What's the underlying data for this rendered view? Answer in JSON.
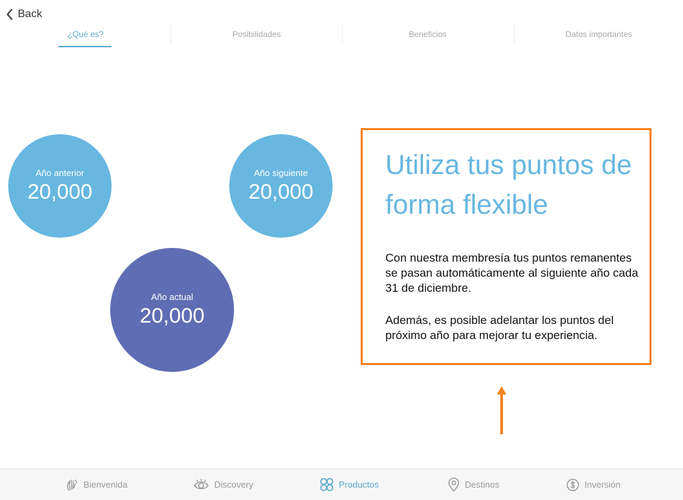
{
  "header": {
    "back_label": "Back"
  },
  "tabs": [
    {
      "label": "¿Qué es?",
      "active": true
    },
    {
      "label": "Posibilidades",
      "active": false
    },
    {
      "label": "Beneficios",
      "active": false
    },
    {
      "label": "Datos importantes",
      "active": false
    }
  ],
  "circles": {
    "previous": {
      "label": "Año anterior",
      "value": "20,000"
    },
    "next": {
      "label": "Año siguiente",
      "value": "20,000"
    },
    "current": {
      "label": "Año actual",
      "value": "20,000"
    }
  },
  "content": {
    "heading": "Utiliza tus puntos de forma flexible",
    "paragraph_1": "Con nuestra membresía tus puntos remanentes se pasan automáticamente al siguiente año cada 31 de diciembre.",
    "paragraph_2": "Además, es posible adelantar los puntos del próximo año para mejorar tu experiencia."
  },
  "bottom_nav": [
    {
      "label": "Bienvenida",
      "icon": "hand-wave-icon",
      "active": false
    },
    {
      "label": "Discovery",
      "icon": "eye-icon",
      "active": false
    },
    {
      "label": "Productos",
      "icon": "clover-icon",
      "active": true
    },
    {
      "label": "Destinos",
      "icon": "location-pin-icon",
      "active": false
    },
    {
      "label": "Inversión",
      "icon": "coin-icon",
      "active": false
    }
  ],
  "colors": {
    "accent": "#5aa9cf",
    "circle_light": "#67b7e0",
    "circle_dark": "#5f6db4",
    "annotation": "#f58220"
  }
}
